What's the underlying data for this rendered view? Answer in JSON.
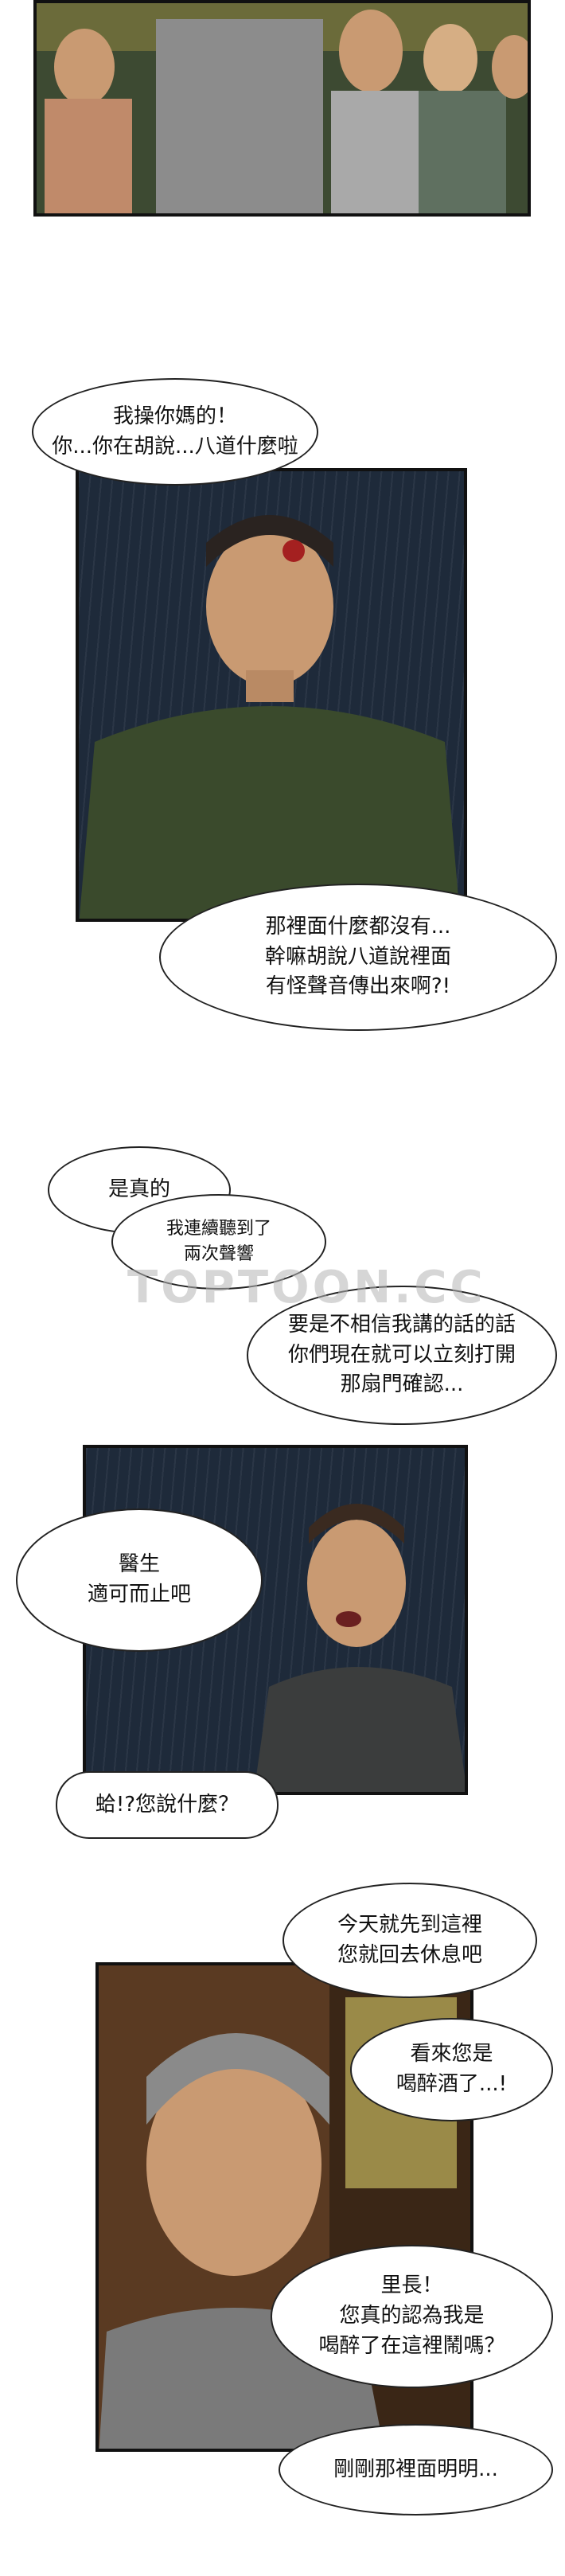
{
  "panels": {
    "p1": {
      "description_hidden": ""
    },
    "p2": {
      "bubble_top": [
        "我操你媽的！",
        "你...你在胡說...八道什麼啦"
      ],
      "bubble_bottom": [
        "那裡面什麼都沒有...",
        "幹嘛胡說八道說裡面",
        "有怪聲音傳出來啊?!"
      ]
    },
    "p3": {
      "bubble_a": "是真的",
      "bubble_b": [
        "我連續聽到了",
        "兩次聲響"
      ],
      "bubble_c": [
        "要是不相信我講的話的話",
        "你們現在就可以立刻打開",
        "那扇門確認..."
      ],
      "bubble_d": [
        "醫生",
        "適可而止吧"
      ],
      "bubble_e": "蛤!?您說什麼？"
    },
    "p4": {
      "bubble_a": [
        "今天就先到這裡",
        "您就回去休息吧"
      ],
      "bubble_b": [
        "看來您是",
        "喝醉酒了...!"
      ],
      "bubble_c": [
        "里長！",
        "您真的認為我是",
        "喝醉了在這裡鬧嗎？"
      ],
      "bubble_d": "剛剛那裡面明明..."
    }
  },
  "watermark": "TOPTOON.CC",
  "colors": {
    "rain_panel": "#1e2a3a",
    "shirt": "#3a4a2c",
    "skin": "#c99a72",
    "room": "#5a3a22"
  }
}
